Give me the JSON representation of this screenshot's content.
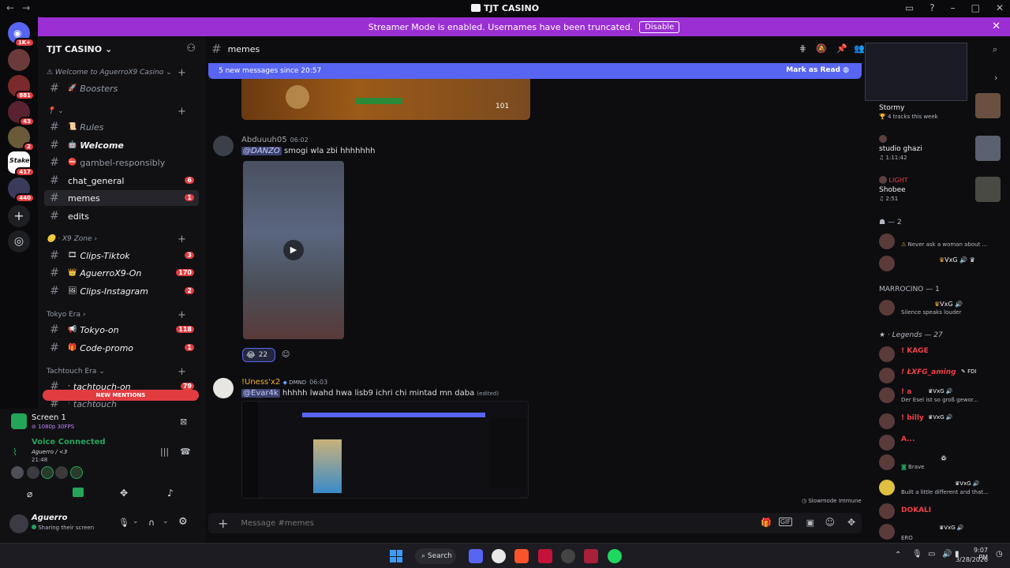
{
  "window": {
    "title": "TJT CASINO",
    "back": "←",
    "forward": "→"
  },
  "banner": {
    "text": "Streamer Mode is enabled. Usernames have been truncated.",
    "button": "Disable"
  },
  "rail": {
    "servers": [
      {
        "badge": "1K+"
      },
      {
        "badge": ""
      },
      {
        "badge": "881"
      },
      {
        "badge": "43"
      },
      {
        "badge": "2"
      },
      {
        "badge": "417"
      },
      {
        "badge": "440"
      }
    ]
  },
  "sidebar": {
    "guild_name": "TJT CASINO",
    "categories": {
      "welcome": "Welcome to AguerroX9 Casino",
      "x9zone": "X9 Zone",
      "tokyo": "Tokyo Era",
      "tachtouch": "Tachtouch Era"
    },
    "channels": {
      "boosters": "Boosters",
      "rules": "Rules",
      "welcome": "Welcome",
      "gambel": "gambel-responsibly",
      "chat_general": "chat_general",
      "chat_general_badge": "6",
      "memes": "memes",
      "memes_badge": "1",
      "edits": "edits",
      "clips_tiktok": "Clips-Tiktok",
      "clips_tiktok_badge": "3",
      "aguerro_on": "AguerroX9-On",
      "aguerro_on_badge": "170",
      "clips_insta": "Clips-Instagram",
      "clips_insta_badge": "2",
      "tokyo_on": "Tokyo-on",
      "tokyo_on_badge": "118",
      "code_promo": "Code-promo",
      "code_promo_badge": "1",
      "tachtouch_on": "tachtouch-on",
      "tachtouch_on_badge": "79",
      "tachtouch": "tachtouch"
    },
    "new_mentions": "NEW MENTIONS"
  },
  "user_panel": {
    "screen_title": "Screen 1",
    "screen_sub": "1080p 30FPS",
    "voice_status": "Voice Connected",
    "voice_channel": "Aguerro / <3",
    "voice_time": "21:48",
    "username": "Aguerro",
    "user_status": "Sharing their screen"
  },
  "chat": {
    "channel": "memes",
    "new_messages": "5 new messages since 20:57",
    "mark_as_read": "Mark as Read",
    "messages": [
      {
        "author": "Abduuuh05",
        "time": "06:02",
        "mention": "@DANZO",
        "text": "smogi wla zbi hhhhhhh",
        "reaction_count": "22"
      },
      {
        "author": "!Uness'x2",
        "tag": "DMND",
        "time": "06:03",
        "mention": "@Evar4k",
        "text": "hhhhh lwahd hwa lisb9 ichri chi mintad mn daba",
        "edited": "(edited)"
      }
    ],
    "embed_score": "101",
    "slowmode": "Slowmode Immune",
    "composer_placeholder": "Message #memes"
  },
  "right_panel": {
    "activities": [
      {
        "name": "Stormy",
        "detail": "4 tracks this week"
      },
      {
        "name": "studio ghazi",
        "detail": "1:11:42"
      },
      {
        "name": "LIGHT",
        "subname": "Shobee",
        "detail": "2:51"
      }
    ],
    "groups": {
      "g1": "— 2",
      "g2": "MARROCINO — 1",
      "g3": "Legends — 27"
    },
    "members": [
      {
        "name": "",
        "status": "Never ask a woman about ..."
      },
      {
        "name": "",
        "status": "",
        "tag": "VxG"
      },
      {
        "name": "",
        "status": "Silence speaks louder",
        "tag": "VxG"
      },
      {
        "name": "! KAGE",
        "status": ""
      },
      {
        "name": "! ŁXFG_aming",
        "status": "",
        "tag": "FDI"
      },
      {
        "name": "! a",
        "status": "Der Esel ist so groß gewor...",
        "tag": "VxG"
      },
      {
        "name": "! billy",
        "status": "",
        "tag": "VxG"
      },
      {
        "name": "A...",
        "status": ""
      },
      {
        "name": "",
        "status": "Brave"
      },
      {
        "name": "",
        "status": "Built a little different and that...",
        "tag": "VxG"
      },
      {
        "name": "DOKALI",
        "status": ""
      },
      {
        "name": "",
        "status": "ERO",
        "tag": "VxG"
      }
    ]
  },
  "taskbar": {
    "search": "Search",
    "time": "9:07 PM",
    "date": "3/28/2026"
  }
}
